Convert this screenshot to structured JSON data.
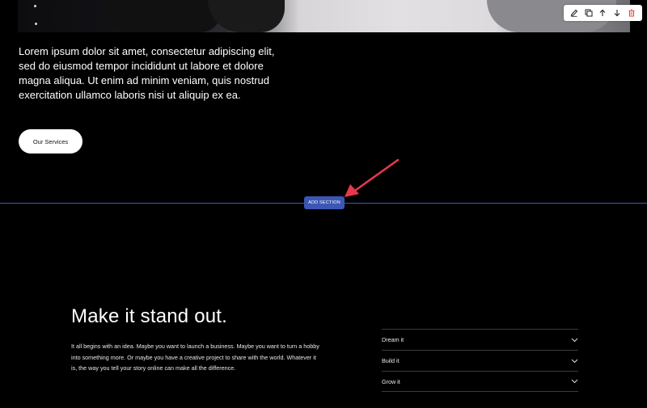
{
  "hero": {
    "paragraph": "Lorem ipsum dolor sit amet, consectetur adipiscing elit, sed do eiusmod tempor incididunt ut labore et dolore magna aliqua. Ut enim ad minim veniam, quis nostrud exercitation ullamco laboris nisi ut aliquip ex ea.",
    "button_label": "Our Services"
  },
  "toolbar": {
    "icons": [
      "edit-icon",
      "duplicate-icon",
      "move-up-icon",
      "move-down-icon",
      "delete-icon"
    ],
    "delete_color": "#e0443c"
  },
  "add_section": {
    "label": "ADD SECTION",
    "color": "#3c56b5"
  },
  "annotation": {
    "arrow_color": "#e8384b"
  },
  "section": {
    "headline": "Make it stand out.",
    "body": "It all begins with an idea. Maybe you want to launch a business. Maybe you want to turn a hobby into something more. Or maybe you have a creative project to share with the world. Whatever it is, the way you tell your story online can make all the difference.",
    "accordion": [
      {
        "label": "Dream it"
      },
      {
        "label": "Build it"
      },
      {
        "label": "Grow it"
      }
    ]
  }
}
